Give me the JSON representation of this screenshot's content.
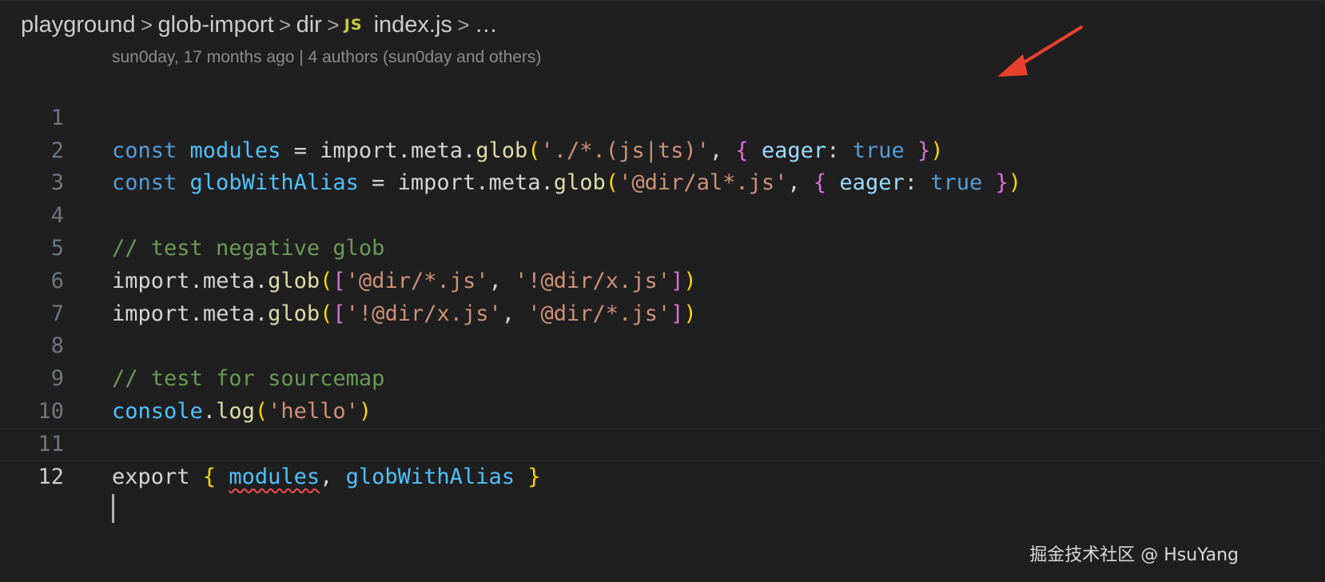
{
  "breadcrumb": {
    "items": [
      "playground",
      "glob-import",
      "dir",
      "index.js",
      "…"
    ],
    "separator": ">",
    "file_icon_label": "JS"
  },
  "blame": {
    "text": "sun0day, 17 months ago | 4 authors (sun0day and others)"
  },
  "editor": {
    "line_numbers": [
      "1",
      "2",
      "3",
      "4",
      "5",
      "6",
      "7",
      "8",
      "9",
      "10",
      "11",
      "12"
    ],
    "current_line": "12",
    "lines": {
      "l1": {
        "kw": "const ",
        "var": "modules",
        "op": " = ",
        "obj": "import",
        "dot1": ".",
        "prop": "meta",
        "dot2": ".",
        "fn": "glob",
        "open": "(",
        "str": "'./*.(js|ts)'",
        "comma": ", ",
        "brace_open": "{",
        "key": " eager",
        "colon": ": ",
        "val": "true",
        "brace_close": " }",
        "close": ")"
      },
      "l2": {
        "kw": "const ",
        "var": "globWithAlias",
        "op": " = ",
        "obj": "import",
        "dot1": ".",
        "prop": "meta",
        "dot2": ".",
        "fn": "glob",
        "open": "(",
        "str": "'@dir/al*.js'",
        "comma": ", ",
        "brace_open": "{",
        "key": " eager",
        "colon": ": ",
        "val": "true",
        "brace_close": " }",
        "close": ")"
      },
      "l4": {
        "comment": "// test negative glob"
      },
      "l5": {
        "obj": "import",
        "dot1": ".",
        "prop": "meta",
        "dot2": ".",
        "fn": "glob",
        "open": "(",
        "bracket_open": "[",
        "str1": "'@dir/*.js'",
        "comma": ", ",
        "str2": "'!@dir/x.js'",
        "bracket_close": "]",
        "close": ")"
      },
      "l6": {
        "obj": "import",
        "dot1": ".",
        "prop": "meta",
        "dot2": ".",
        "fn": "glob",
        "open": "(",
        "bracket_open": "[",
        "str1": "'!@dir/x.js'",
        "comma": ", ",
        "str2": "'@dir/*.js'",
        "bracket_close": "]",
        "close": ")"
      },
      "l8": {
        "comment": "// test for sourcemap"
      },
      "l9": {
        "obj": "console",
        "dot": ".",
        "fn": "log",
        "open": "(",
        "str": "'hello'",
        "close": ")"
      },
      "l11": {
        "kw": "export ",
        "brace_open": "{",
        "sp": " ",
        "id1": "modules",
        "comma": ", ",
        "id2": "globWithAlias",
        "brace_close": " }"
      }
    }
  },
  "annotation": {
    "arrow_color": "#e8422f"
  },
  "watermark": {
    "text": "掘金技术社区 @ HsuYang"
  },
  "colors": {
    "background": "#1f1f1f",
    "keyword": "#569cd6",
    "function": "#dcdcaa",
    "string": "#ce9178",
    "comment": "#6a9955",
    "variable": "#4fc1ff",
    "identifier": "#9cdcfe",
    "bracket_level1": "#ffd700",
    "bracket_level2": "#da70d6",
    "bracket_level3": "#179fff",
    "error_squiggle": "#f14c4c"
  }
}
